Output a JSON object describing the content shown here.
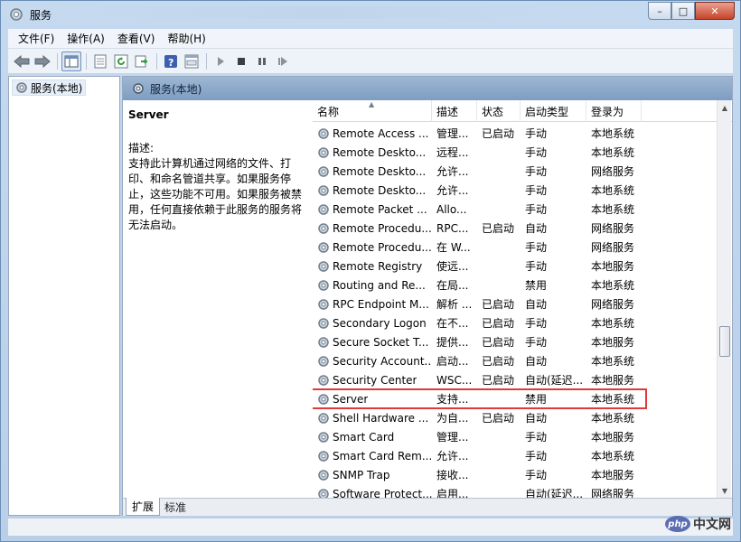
{
  "window": {
    "title": "服务",
    "controls": {
      "minimize": "–",
      "maximize": "□",
      "close": "✕"
    }
  },
  "menu": [
    "文件(F)",
    "操作(A)",
    "查看(V)",
    "帮助(H)"
  ],
  "toolbar": {
    "icons": [
      "back-icon",
      "forward-icon",
      "console-tree-icon",
      "export-list-icon",
      "refresh-icon",
      "export-icon",
      "help-icon",
      "properties-icon",
      "start-icon",
      "stop-icon",
      "pause-icon",
      "restart-icon"
    ]
  },
  "tree": {
    "root": "服务(本地)"
  },
  "pane_header": "服务(本地)",
  "detail": {
    "title": "Server",
    "desc_label": "描述:",
    "desc_text": "支持此计算机通过网络的文件、打印、和命名管道共享。如果服务停止，这些功能不可用。如果服务被禁用，任何直接依赖于此服务的服务将无法启动。"
  },
  "columns": [
    "名称",
    "描述",
    "状态",
    "启动类型",
    "登录为"
  ],
  "services": [
    {
      "name": "Remote Access ...",
      "desc": "管理...",
      "status": "已启动",
      "startup": "手动",
      "logon": "本地系统"
    },
    {
      "name": "Remote Deskto...",
      "desc": "远程...",
      "status": "",
      "startup": "手动",
      "logon": "本地系统"
    },
    {
      "name": "Remote Deskto...",
      "desc": "允许...",
      "status": "",
      "startup": "手动",
      "logon": "网络服务"
    },
    {
      "name": "Remote Deskto...",
      "desc": "允许...",
      "status": "",
      "startup": "手动",
      "logon": "本地系统"
    },
    {
      "name": "Remote Packet ...",
      "desc": "Allo...",
      "status": "",
      "startup": "手动",
      "logon": "本地系统"
    },
    {
      "name": "Remote Procedu...",
      "desc": "RPC...",
      "status": "已启动",
      "startup": "自动",
      "logon": "网络服务"
    },
    {
      "name": "Remote Procedu...",
      "desc": "在 W...",
      "status": "",
      "startup": "手动",
      "logon": "网络服务"
    },
    {
      "name": "Remote Registry",
      "desc": "使远...",
      "status": "",
      "startup": "手动",
      "logon": "本地服务"
    },
    {
      "name": "Routing and Re...",
      "desc": "在局...",
      "status": "",
      "startup": "禁用",
      "logon": "本地系统"
    },
    {
      "name": "RPC Endpoint M...",
      "desc": "解析 ...",
      "status": "已启动",
      "startup": "自动",
      "logon": "网络服务"
    },
    {
      "name": "Secondary Logon",
      "desc": "在不...",
      "status": "已启动",
      "startup": "手动",
      "logon": "本地系统"
    },
    {
      "name": "Secure Socket T...",
      "desc": "提供...",
      "status": "已启动",
      "startup": "手动",
      "logon": "本地服务"
    },
    {
      "name": "Security Account...",
      "desc": "启动...",
      "status": "已启动",
      "startup": "自动",
      "logon": "本地系统"
    },
    {
      "name": "Security Center",
      "desc": "WSC...",
      "status": "已启动",
      "startup": "自动(延迟...",
      "logon": "本地服务"
    },
    {
      "name": "Server",
      "desc": "支持...",
      "status": "",
      "startup": "禁用",
      "logon": "本地系统",
      "highlighted": true
    },
    {
      "name": "Shell Hardware ...",
      "desc": "为自...",
      "status": "已启动",
      "startup": "自动",
      "logon": "本地系统"
    },
    {
      "name": "Smart Card",
      "desc": "管理...",
      "status": "",
      "startup": "手动",
      "logon": "本地服务"
    },
    {
      "name": "Smart Card Rem...",
      "desc": "允许...",
      "status": "",
      "startup": "手动",
      "logon": "本地系统"
    },
    {
      "name": "SNMP Trap",
      "desc": "接收...",
      "status": "",
      "startup": "手动",
      "logon": "本地服务"
    },
    {
      "name": "Software Protect...",
      "desc": "启用...",
      "status": "",
      "startup": "自动(延迟...",
      "logon": "网络服务"
    }
  ],
  "tabs": [
    "扩展",
    "标准"
  ],
  "watermark": {
    "logo": "php",
    "text": "中文网"
  },
  "colors": {
    "highlight_border": "#e0393a",
    "header_bg": "#8aa7c9"
  }
}
